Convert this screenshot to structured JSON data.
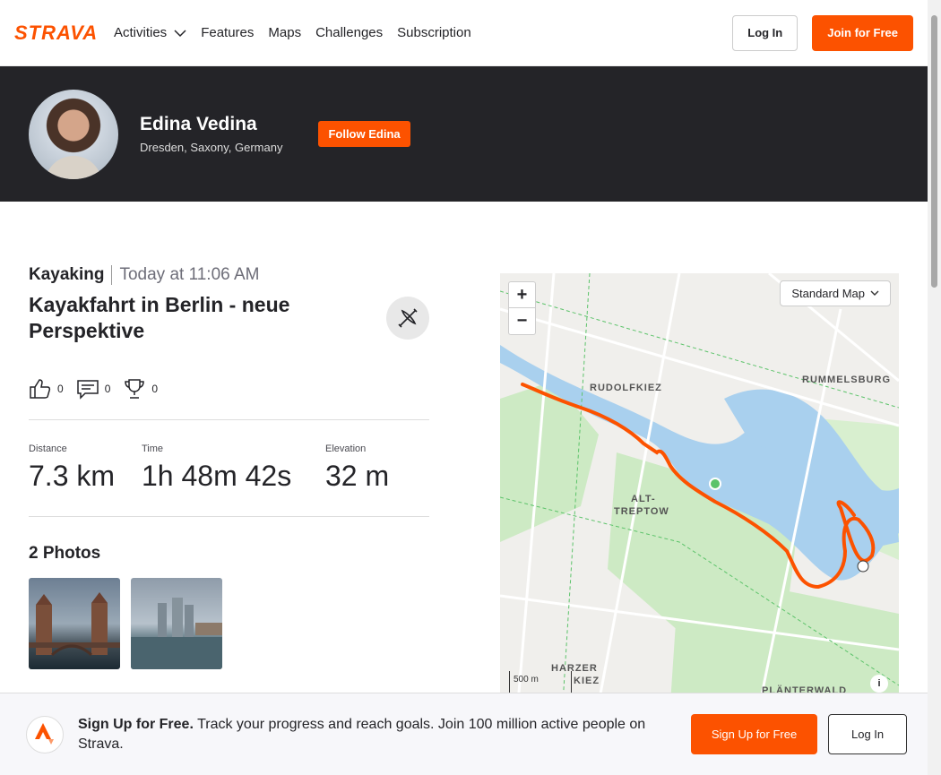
{
  "nav": {
    "logo": "STRAVA",
    "items": [
      "Activities",
      "Features",
      "Maps",
      "Challenges",
      "Subscription"
    ],
    "login": "Log In",
    "join": "Join for Free"
  },
  "athlete": {
    "name": "Edina Vedina",
    "location": "Dresden, Saxony, Germany",
    "follow": "Follow Edina"
  },
  "activity": {
    "sport": "Kayaking",
    "when": "Today at 11:06 AM",
    "title": "Kayakfahrt in Berlin - neue Perspektive",
    "kudos": "0",
    "comments": "0",
    "achievements": "0",
    "stats": [
      {
        "label": "Distance",
        "value": "7.3 km"
      },
      {
        "label": "Time",
        "value": "1h 48m 42s"
      },
      {
        "label": "Elevation",
        "value": "32 m"
      }
    ],
    "photos_heading": "2 Photos"
  },
  "map": {
    "zoom_in": "+",
    "zoom_out": "−",
    "map_type": "Standard Map",
    "labels": [
      "RUDOLFKIEZ",
      "RUMMELSBURG",
      "ALT-",
      "TREPTOW",
      "HARZER",
      "KIEZ",
      "PLÄNTERWALD"
    ],
    "scale": "500 m",
    "colors": {
      "route": "#fc5200",
      "water": "#a9d0ee",
      "park": "#cdeac4"
    }
  },
  "banner": {
    "bold": "Sign Up for Free.",
    "text": "Track your progress and reach goals. Join 100 million active people on Strava.",
    "signup": "Sign Up for Free",
    "login": "Log In"
  }
}
